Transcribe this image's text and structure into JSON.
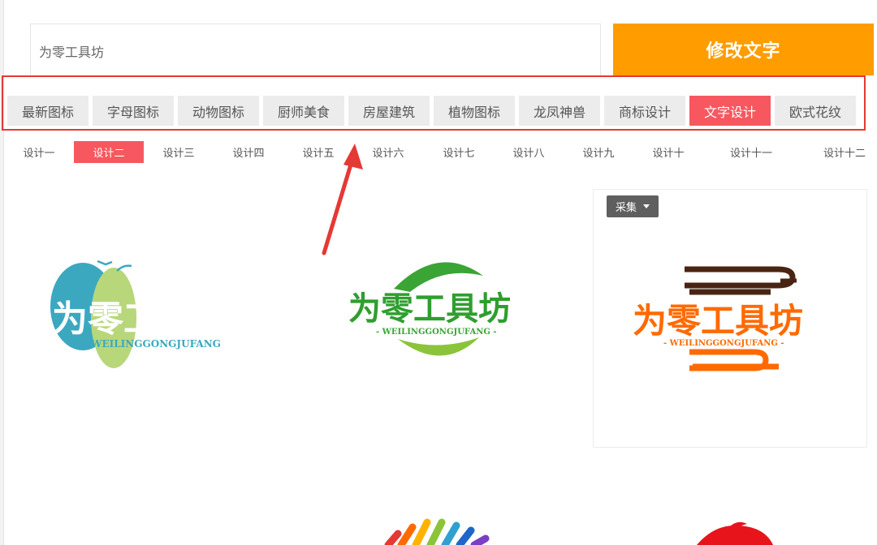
{
  "search": {
    "value": "为零工具坊"
  },
  "submit_label": "修改文字",
  "categories": [
    {
      "label": "最新图标"
    },
    {
      "label": "字母图标"
    },
    {
      "label": "动物图标"
    },
    {
      "label": "厨师美食"
    },
    {
      "label": "房屋建筑"
    },
    {
      "label": "植物图标"
    },
    {
      "label": "龙凤神兽"
    },
    {
      "label": "商标设计"
    },
    {
      "label": "文字设计",
      "active": true
    },
    {
      "label": "欧式花纹"
    }
  ],
  "subcategories": [
    {
      "label": "设计一"
    },
    {
      "label": "设计二",
      "active": true
    },
    {
      "label": "设计三"
    },
    {
      "label": "设计四"
    },
    {
      "label": "设计五"
    },
    {
      "label": "设计六"
    },
    {
      "label": "设计七"
    },
    {
      "label": "设计八"
    },
    {
      "label": "设计九"
    },
    {
      "label": "设计十"
    },
    {
      "label": "设计十一"
    },
    {
      "label": "设计十二"
    }
  ],
  "collect_label": "采集",
  "logos": [
    {
      "name": "为零工具坊",
      "subtitle": "WEILINGGONGJUFANG",
      "color": "#2ea7c8"
    },
    {
      "name": "为零工具坊",
      "subtitle": "- WEILINGGONGJUFANG -",
      "color": "#2f9e2f"
    },
    {
      "name": "为零工具坊",
      "subtitle": "- WEILINGGONGJUFANG -",
      "color": "#ff6a00"
    }
  ],
  "colors": {
    "accent": "#ff9c00",
    "active_tab": "#f7575f",
    "highlight_border": "#e53935",
    "arrow": "#e53935"
  }
}
